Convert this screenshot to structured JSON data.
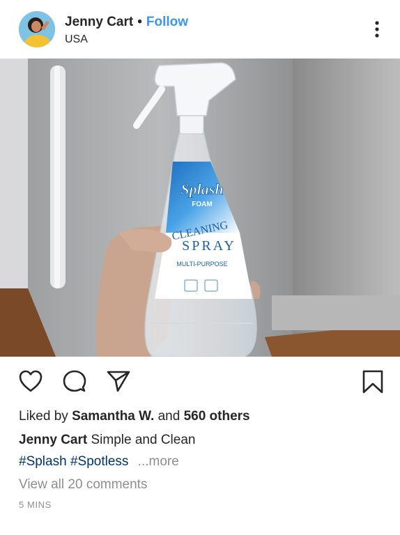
{
  "post": {
    "username": "Jenny Cart",
    "separator": "•",
    "follow_label": "Follow",
    "location": "USA",
    "more_icon": "more-vertical-icon"
  },
  "photo": {
    "label_text_1": "Splash",
    "label_text_2": "FOAM",
    "label_text_3": "CLEANING",
    "label_text_4": "SPRAY",
    "label_text_5": "MULTI-PURPOSE"
  },
  "actions": {
    "like_icon": "heart-icon",
    "comment_icon": "comment-icon",
    "share_icon": "paper-plane-icon",
    "save_icon": "bookmark-icon"
  },
  "likes": {
    "prefix": "Liked by",
    "user": "Samantha W.",
    "conjunction": "and",
    "others": "560 others"
  },
  "caption": {
    "username": "Jenny Cart",
    "text": "Simple and Clean",
    "hashtags": [
      "#Splash",
      "#Spotless"
    ],
    "more": "...more"
  },
  "comments_link": "View all 20 comments",
  "timestamp": "5 MINS",
  "colors": {
    "follow": "#3897f0",
    "hashtag": "#003569",
    "muted": "#8e8e8e",
    "text": "#262626"
  }
}
